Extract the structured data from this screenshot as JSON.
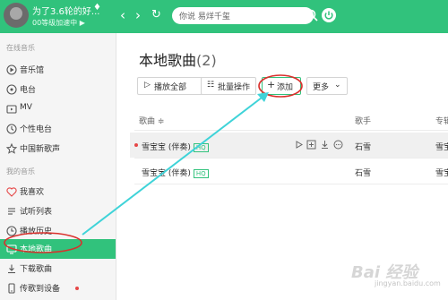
{
  "header": {
    "username": "为了3.6轮的好...",
    "vip_status": "00等级加速中 ▶",
    "back_icon": "‹",
    "forward_icon": "›",
    "refresh_icon": "↻",
    "search_placeholder": "你说 易烊千玺",
    "accent": "#31c27c"
  },
  "sidebar": {
    "online_title": "在线音乐",
    "online_items": [
      {
        "label": "音乐馆",
        "icon": "music-hall-icon"
      },
      {
        "label": "电台",
        "icon": "radio-icon"
      },
      {
        "label": "MV",
        "icon": "mv-icon"
      },
      {
        "label": "个性电台",
        "icon": "personal-radio-icon"
      },
      {
        "label": "中国新歌声",
        "icon": "star-icon"
      }
    ],
    "my_title": "我的音乐",
    "my_items": [
      {
        "label": "我喜欢",
        "icon": "heart-icon"
      },
      {
        "label": "试听列表",
        "icon": "list-icon"
      },
      {
        "label": "播放历史",
        "icon": "clock-icon"
      },
      {
        "label": "本地歌曲",
        "icon": "monitor-icon"
      },
      {
        "label": "下载歌曲",
        "icon": "download-icon"
      },
      {
        "label": "传歌到设备",
        "icon": "device-icon"
      }
    ]
  },
  "main": {
    "title": "本地歌曲",
    "count": "(2)",
    "buttons": {
      "play_all": "播放全部",
      "batch": "批量操作",
      "add": "添加",
      "more": "更多"
    },
    "columns": {
      "song": "歌曲 ≑",
      "singer": "歌手",
      "album": "专辑"
    },
    "rows": [
      {
        "song": "雪宝宝 (伴奏)",
        "quality": "HQ",
        "singer": "石雪",
        "album": "雪宝"
      },
      {
        "song": "雪宝宝 (伴奏)",
        "quality": "HQ",
        "singer": "石雪",
        "album": "雪宝"
      }
    ]
  },
  "watermark": {
    "logo": "Bai 经验",
    "url": "jingyan.baidu.com"
  }
}
